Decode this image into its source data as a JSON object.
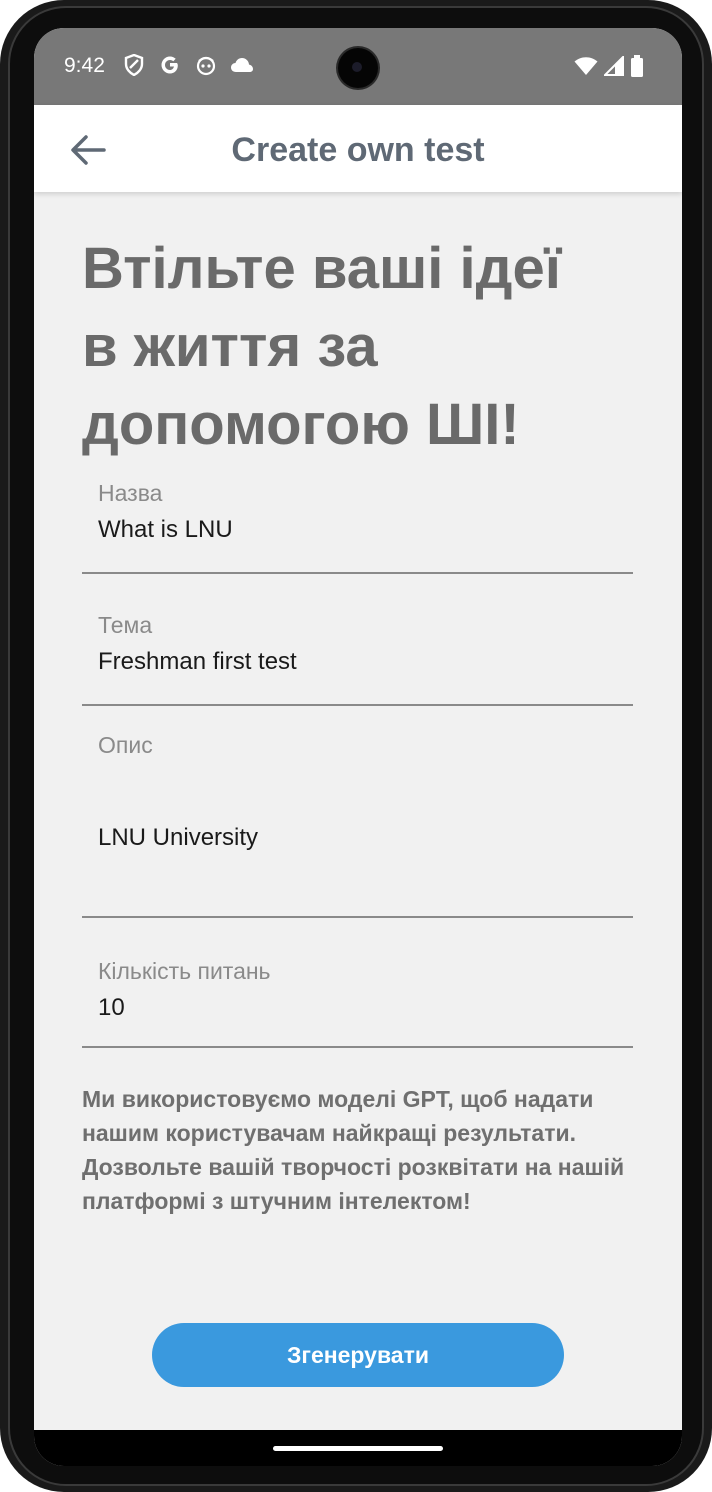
{
  "status_bar": {
    "time": "9:42",
    "left_icons": [
      "shield-icon",
      "google-icon",
      "face-icon",
      "cloud-icon"
    ],
    "right_icons": [
      "wifi-icon",
      "signal-icon",
      "battery-icon"
    ]
  },
  "app_bar": {
    "title": "Create own test",
    "back_icon": "arrow-left-icon"
  },
  "headline": "Втільте ваші ідеї в життя за допомогою ШІ!",
  "form": {
    "name": {
      "label": "Назва",
      "value": "What is LNU"
    },
    "topic": {
      "label": "Тема",
      "value": "Freshman first test"
    },
    "description": {
      "label": "Опис",
      "value": "LNU University"
    },
    "questions_count": {
      "label": "Кількість питань",
      "value": "10"
    }
  },
  "info_text": "Ми використовуємо моделі GPT, щоб надати нашим користувачам найкращі результати. Дозвольте вашій творчості розквітати на нашій платформі з штучним інтелектом!",
  "generate_button": {
    "label": "Згенерувати"
  },
  "colors": {
    "status_bar": "#787878",
    "app_bar": "#ffffff",
    "title": "#5f6975",
    "background": "#f1f1f1",
    "accent": "#3a99de",
    "headline": "#6a6a6a"
  }
}
